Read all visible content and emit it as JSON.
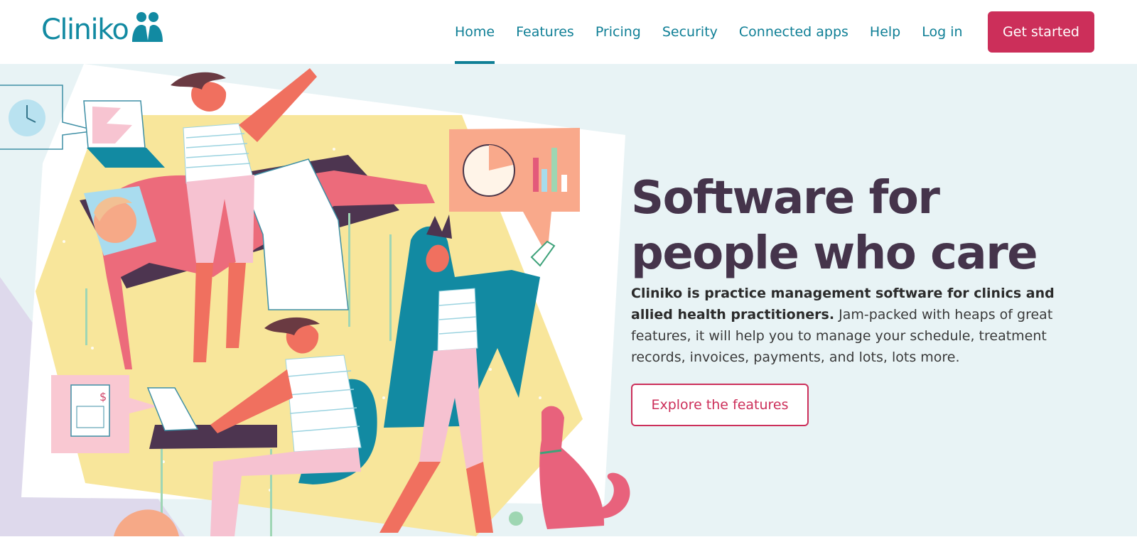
{
  "brand": {
    "name": "Cliniko",
    "logo_icon": "two-people-logo-icon",
    "primary_color": "#128aa2",
    "accent_color": "#cc2f5a",
    "headline_color": "#45344b"
  },
  "nav": {
    "items": [
      {
        "label": "Home",
        "active": true
      },
      {
        "label": "Features",
        "active": false
      },
      {
        "label": "Pricing",
        "active": false
      },
      {
        "label": "Security",
        "active": false
      },
      {
        "label": "Connected apps",
        "active": false
      },
      {
        "label": "Help",
        "active": false
      },
      {
        "label": "Log in",
        "active": false
      }
    ],
    "cta_label": "Get started"
  },
  "hero": {
    "headline": "Software for people who care",
    "intro_bold": "Cliniko is practice management software for clinics and allied health practitioners.",
    "intro_rest": " Jam-packed with heaps of great features, it will help you to manage your schedule, treatment records, invoices, payments, and lots, lots more.",
    "button_label": "Explore the features"
  }
}
